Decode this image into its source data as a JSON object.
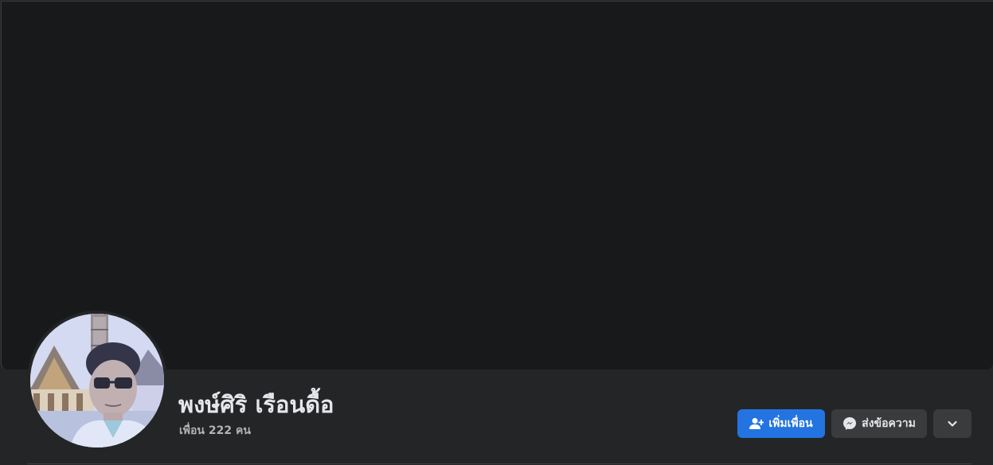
{
  "profile": {
    "name": "พงษ์ศิริ เรือนดื้อ",
    "friends_text": "เพื่อน 222 คน"
  },
  "actions": {
    "add_friend_label": "เพิ่มเพื่อน",
    "message_label": "ส่งข้อความ",
    "more_icon": "chevron-down-icon",
    "add_friend_icon": "add-user-icon",
    "message_icon": "messenger-icon"
  },
  "colors": {
    "background": "#242526",
    "cover": "#18191b",
    "primary_button": "#2374e1",
    "secondary_button": "#3a3b3c",
    "text_primary": "#e4e6eb",
    "text_secondary": "#b0b3b8"
  }
}
